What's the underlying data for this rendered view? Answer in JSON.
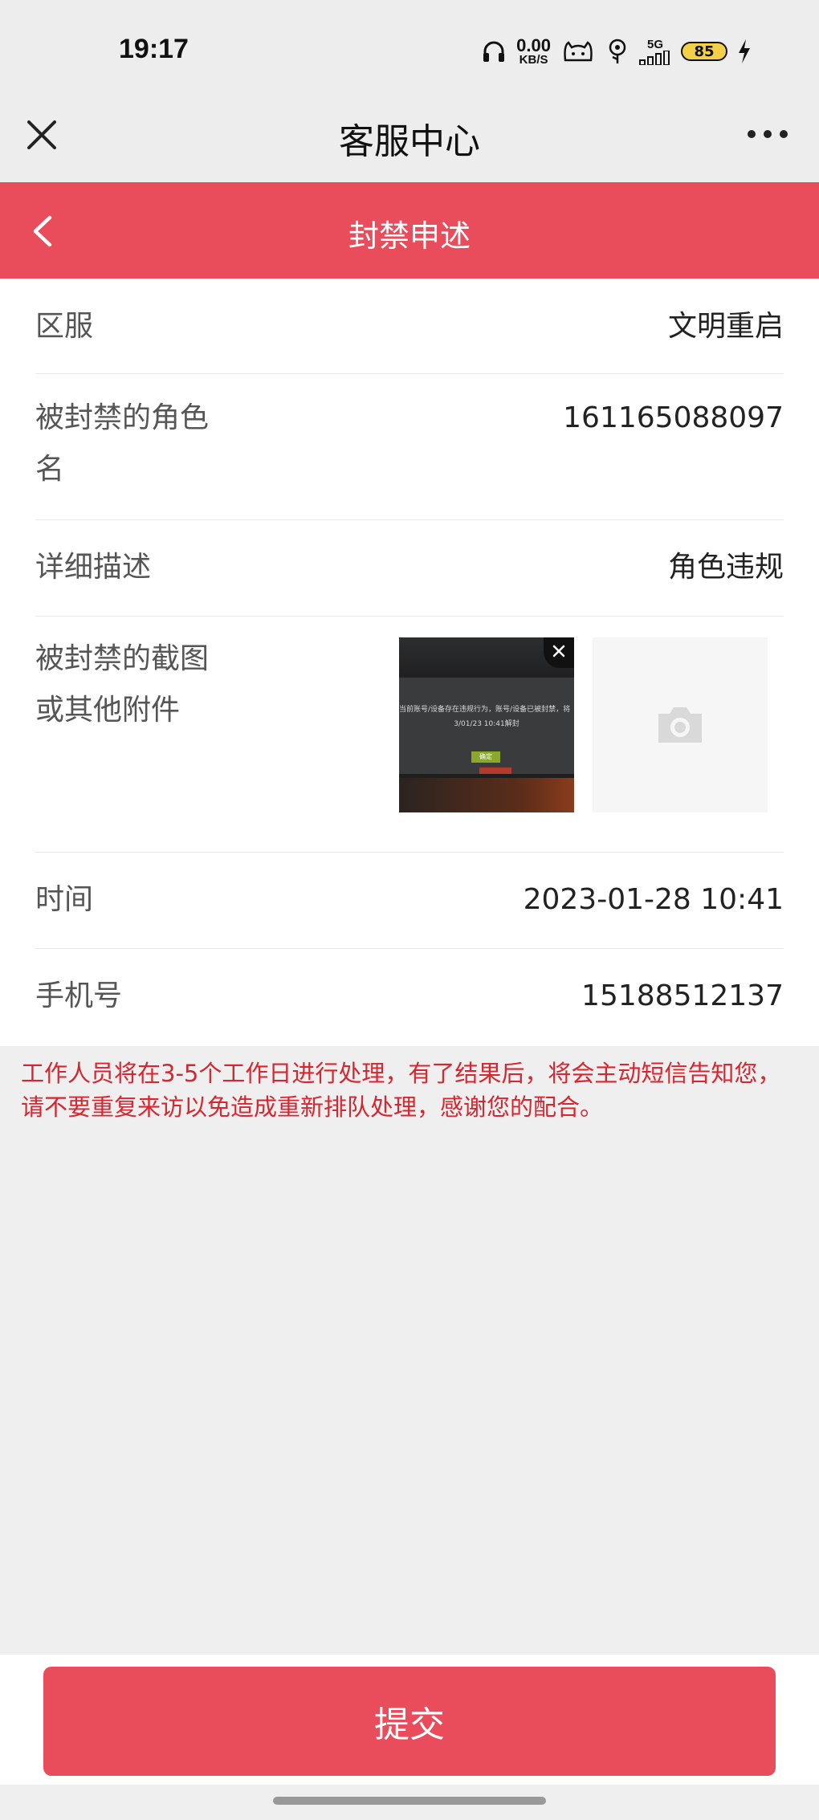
{
  "status_bar": {
    "time": "19:17",
    "net_speed_value": "0.00",
    "net_speed_unit": "KB/S",
    "network_label": "5G",
    "battery": "85",
    "icons": [
      "headphones-icon",
      "cat-icon",
      "flower-icon",
      "signal-icon",
      "battery-icon",
      "charging-icon"
    ]
  },
  "nav": {
    "title": "客服中心",
    "close_icon": "close-icon",
    "more_icon": "more-icon"
  },
  "header": {
    "title": "封禁申述",
    "back_icon": "chevron-left-icon",
    "color": "#e94d5b"
  },
  "form": {
    "server_label": "区服",
    "server_value": "文明重启",
    "role_label_line1": "被封禁的角色",
    "role_label_line2": "名",
    "role_value": "161165088097",
    "desc_label": "详细描述",
    "desc_value": "角色违规",
    "attach_label_line1": "被封禁的截图",
    "attach_label_line2": "或其他附件",
    "time_label": "时间",
    "time_value": "2023-01-28 10:41",
    "phone_label": "手机号",
    "phone_value": "15188512137"
  },
  "attachment": {
    "screenshot_text1": "当前账号/设备存在违规行为，账号/设备已被封禁，将",
    "screenshot_text2": "3/01/23 10:41解封",
    "screenshot_text3": "确定",
    "upload_icon": "camera-icon"
  },
  "notice": "工作人员将在3-5个工作日进行处理，有了结果后，将会主动短信告知您，请不要重复来访以免造成重新排队处理，感谢您的配合。",
  "footer": {
    "submit_label": "提交"
  }
}
